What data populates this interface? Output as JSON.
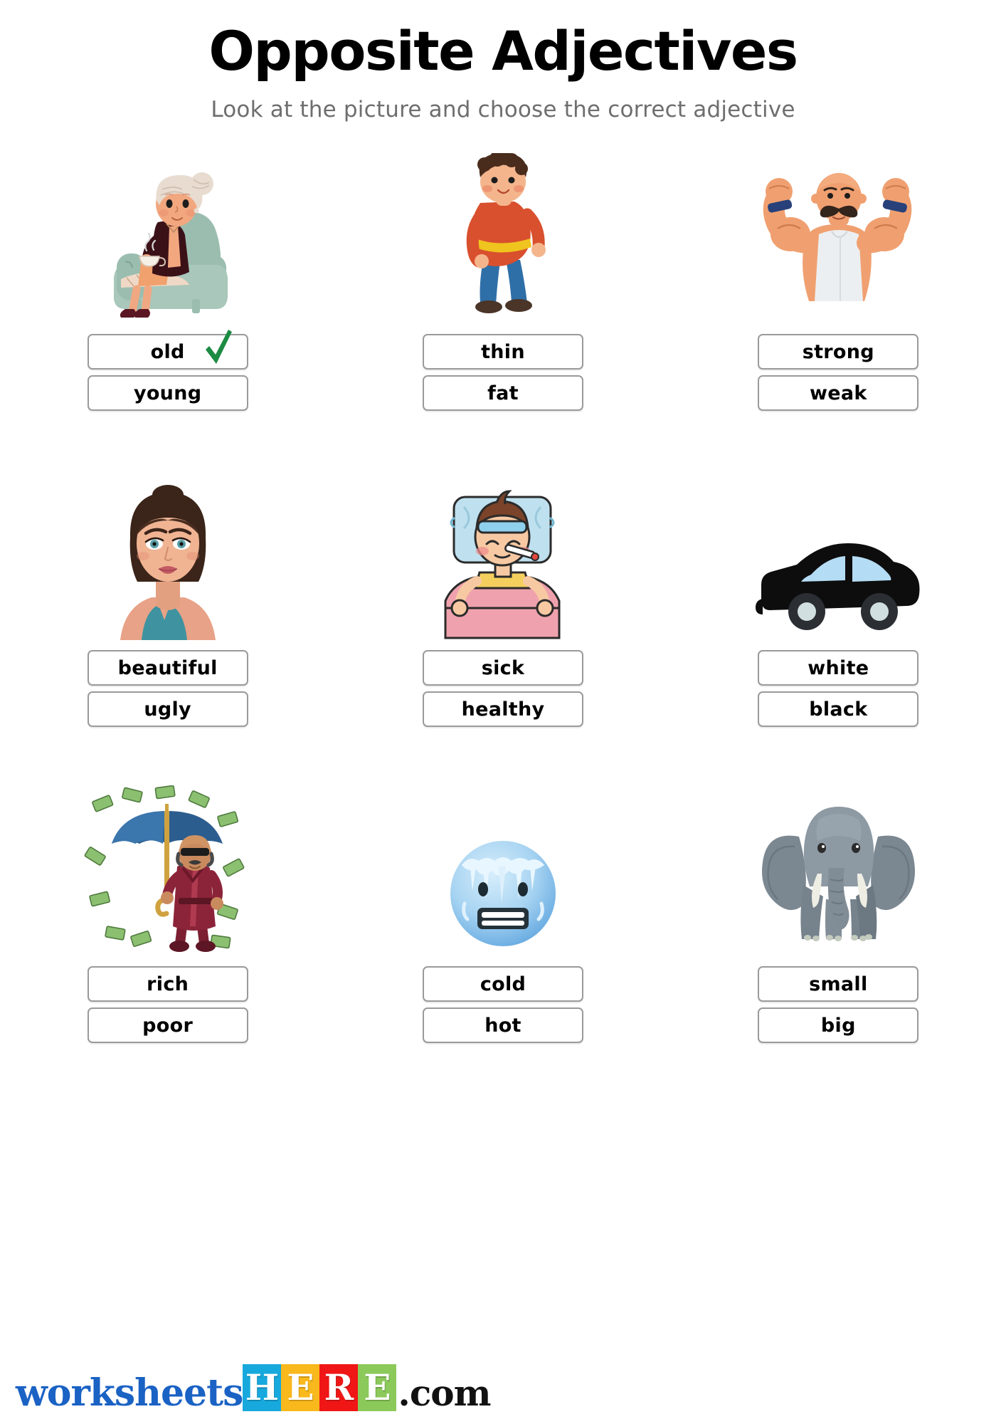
{
  "header": {
    "title": "Opposite Adjectives",
    "subtitle": "Look at the picture and choose the correct adjective"
  },
  "colors": {
    "box_border": "#9a9a9a",
    "check_green": "#1c8b43",
    "subtitle_gray": "#6e6e6e",
    "logo_blue": "#1a62c4",
    "tile_cyan": "#17a9dd",
    "tile_amber": "#f9b81c",
    "tile_red": "#f01616",
    "tile_green": "#8bc95b",
    "chair_green": "#9bbdb0",
    "car_black": "#0d0d0d",
    "car_window": "#b5dcf5"
  },
  "items": [
    {
      "id": "old-young",
      "image_name": "elderly-woman-in-armchair-illustration",
      "options": [
        {
          "label": "old",
          "correct": true
        },
        {
          "label": "young",
          "correct": false
        }
      ]
    },
    {
      "id": "thin-fat",
      "image_name": "overweight-boy-illustration",
      "options": [
        {
          "label": "thin",
          "correct": false
        },
        {
          "label": "fat",
          "correct": false
        }
      ]
    },
    {
      "id": "strong-weak",
      "image_name": "muscular-strongman-illustration",
      "options": [
        {
          "label": "strong",
          "correct": false
        },
        {
          "label": "weak",
          "correct": false
        }
      ]
    },
    {
      "id": "beautiful-ugly",
      "image_name": "beautiful-woman-portrait-illustration",
      "options": [
        {
          "label": "beautiful",
          "correct": false
        },
        {
          "label": "ugly",
          "correct": false
        }
      ]
    },
    {
      "id": "sick-healthy",
      "image_name": "sick-child-in-bed-illustration",
      "options": [
        {
          "label": "sick",
          "correct": false
        },
        {
          "label": "healthy",
          "correct": false
        }
      ]
    },
    {
      "id": "white-black",
      "image_name": "black-car-illustration",
      "options": [
        {
          "label": "white",
          "correct": false
        },
        {
          "label": "black",
          "correct": false
        }
      ]
    },
    {
      "id": "rich-poor",
      "image_name": "rich-man-with-money-umbrella-illustration",
      "options": [
        {
          "label": "rich",
          "correct": false
        },
        {
          "label": "poor",
          "correct": false
        }
      ]
    },
    {
      "id": "cold-hot",
      "image_name": "freezing-cold-face-emoji",
      "options": [
        {
          "label": "cold",
          "correct": false
        },
        {
          "label": "hot",
          "correct": false
        }
      ]
    },
    {
      "id": "small-big",
      "image_name": "elephant-illustration",
      "options": [
        {
          "label": "small",
          "correct": false
        },
        {
          "label": "big",
          "correct": false
        }
      ]
    }
  ],
  "footer": {
    "brand_word": "worksheets",
    "tiles": [
      "H",
      "E",
      "R",
      "E"
    ],
    "suffix": ".com"
  }
}
